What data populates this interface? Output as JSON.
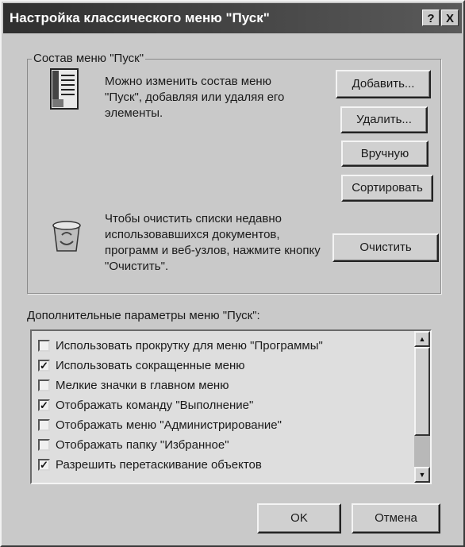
{
  "window": {
    "title": "Настройка классического меню \"Пуск\"",
    "help_button": "?",
    "close_button": "X"
  },
  "group": {
    "legend": "Состав меню \"Пуск\"",
    "description": "Можно изменить состав меню \"Пуск\", добавляя или удаляя его элементы.",
    "add_button": "Добавить...",
    "remove_button": "Удалить...",
    "manual_button": "Вручную",
    "sort_button": "Сортировать",
    "clear_description": "Чтобы очистить списки недавно использовавшихся документов, программ и веб-узлов, нажмите кнопку \"Очистить\".",
    "clear_button": "Очистить",
    "menu_icon": "start-menu-list-icon",
    "recycle_icon": "recycle-bin-icon"
  },
  "advanced": {
    "label": "Дополнительные параметры меню \"Пуск\":",
    "items": [
      {
        "label": "Использовать прокрутку для меню \"Программы\"",
        "checked": false
      },
      {
        "label": "Использовать сокращенные меню",
        "checked": true
      },
      {
        "label": "Мелкие значки в главном меню",
        "checked": false
      },
      {
        "label": "Отображать команду \"Выполнение\"",
        "checked": true
      },
      {
        "label": "Отображать меню \"Администрирование\"",
        "checked": false
      },
      {
        "label": "Отображать папку \"Избранное\"",
        "checked": false
      },
      {
        "label": "Разрешить перетаскивание объектов",
        "checked": true
      }
    ],
    "check_mark": "✓",
    "scroll_up": "▲",
    "scroll_down": "▼"
  },
  "footer": {
    "ok_button": "OK",
    "cancel_button": "Отмена"
  }
}
